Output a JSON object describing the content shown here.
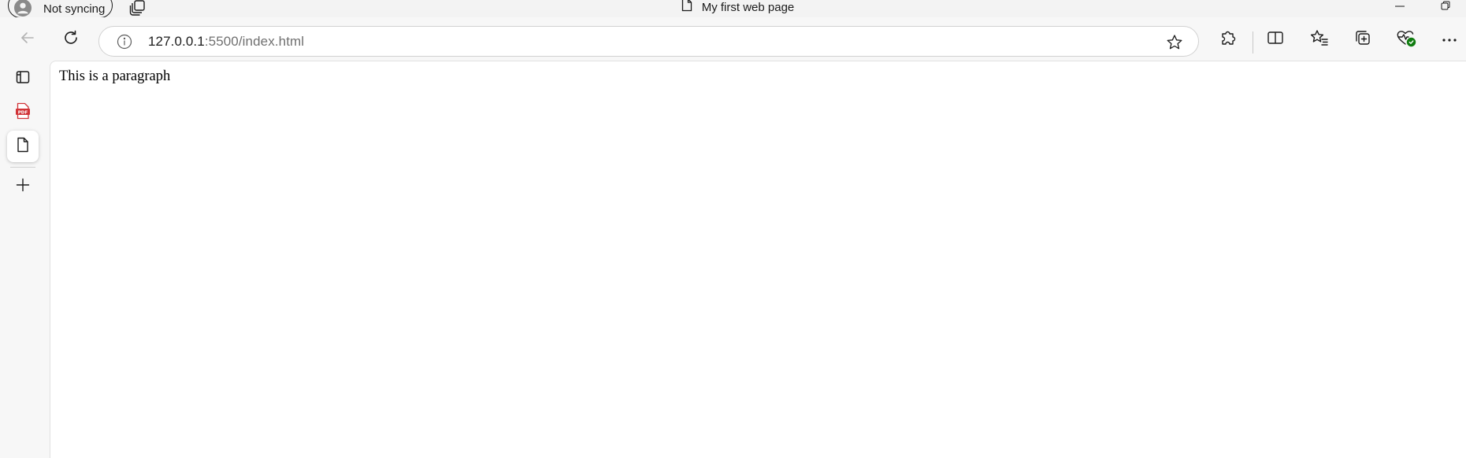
{
  "window": {
    "profile_label": "Not syncing",
    "tab_title": "My first web page"
  },
  "address_bar": {
    "url_host": "127.0.0.1",
    "url_rest": ":5500/index.html"
  },
  "icons": {
    "profile": "person-icon",
    "workspaces": "workspaces-icon",
    "page": "page-icon",
    "minimize": "minimize-icon",
    "restore": "restore-icon",
    "back": "back-arrow-icon",
    "refresh": "refresh-icon",
    "info": "info-icon",
    "favorite": "star-icon",
    "extensions": "puzzle-icon",
    "split_screen": "split-screen-icon",
    "favorites": "favorites-icon",
    "collections": "collections-icon",
    "browser_essentials": "heart-pulse-icon",
    "more": "more-dots-icon",
    "vertical_tabs": "vertical-tabs-icon",
    "pdf_tab": "pdf-icon",
    "new_tab": "plus-icon"
  },
  "sidebar_tabs": [
    {
      "label": "PDF"
    }
  ],
  "colors": {
    "pdf_red": "#d13438",
    "essentials_green": "#107c10"
  },
  "page": {
    "paragraph": "This is a paragraph"
  }
}
